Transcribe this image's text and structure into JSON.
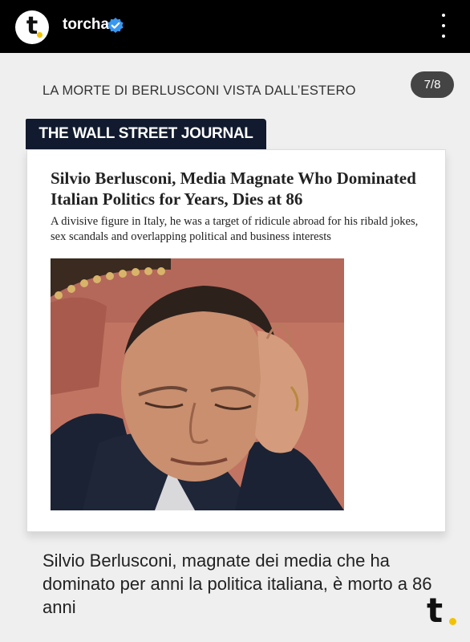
{
  "header": {
    "avatar_letter": "t",
    "username": "torcha",
    "verified_icon": "verified-badge-icon",
    "menu_icon": "more-vertical-icon"
  },
  "post": {
    "section_title": "LA MORTE DI BERLUSCONI VISTA DALL’ESTERO",
    "page_indicator": "7/8",
    "source": "THE WALL STREET JOURNAL",
    "headline": "Silvio Berlusconi, Media Magnate Who Dominated Italian Politics for Years, Dies at 86",
    "subheadline": "A divisive figure in Italy, he was a target of ridicule abroad for his ribald jokes, sex scandals and overlapping political and business interests",
    "photo": "portrait-photo",
    "caption": "Silvio Berlusconi, magnate dei media che ha dominato per anni la politica italiana, è morto a 86 anni",
    "brand_mark_letter": "t"
  },
  "colors": {
    "topbar": "#000000",
    "background": "#efefef",
    "source_label_bg": "#111a2e",
    "accent_yellow": "#f2c200",
    "verified_blue": "#3897f0",
    "badge_bg": "#444444"
  }
}
